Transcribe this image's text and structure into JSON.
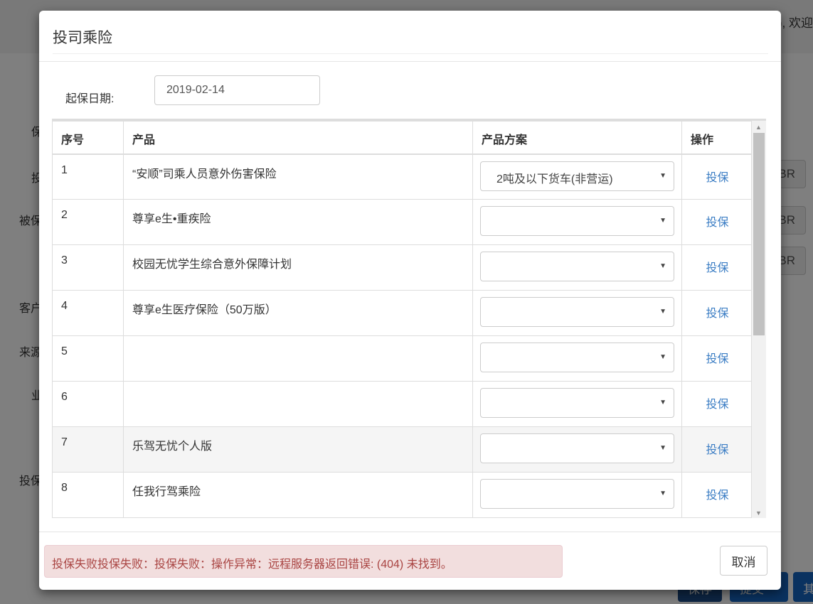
{
  "background": {
    "welcome": "), 欢迎",
    "labels": [
      "保",
      "投",
      "被保",
      "客户",
      "来源",
      "业",
      "投保"
    ],
    "br_buttons": [
      "BR",
      "BR",
      "BR"
    ],
    "bottom_buttons": [
      "保存",
      "提交",
      "其"
    ]
  },
  "modal": {
    "title": "投司乘险",
    "date_label": "起保日期:",
    "date_value": "2019-02-14",
    "columns": [
      "序号",
      "产品",
      "产品方案",
      "操作"
    ],
    "rows": [
      {
        "no": "1",
        "product": "“安顺”司乘人员意外伤害保险",
        "plan": "2吨及以下货车(非营运)",
        "action": "投保"
      },
      {
        "no": "2",
        "product": "尊享e生•重疾险",
        "plan": "",
        "action": "投保"
      },
      {
        "no": "3",
        "product": "校园无忧学生综合意外保障计划",
        "plan": "",
        "action": "投保"
      },
      {
        "no": "4",
        "product": "尊享e生医疗保险（50万版）",
        "plan": "",
        "action": "投保"
      },
      {
        "no": "5",
        "product": "",
        "plan": "",
        "action": "投保"
      },
      {
        "no": "6",
        "product": "",
        "plan": "",
        "action": "投保"
      },
      {
        "no": "7",
        "product": "乐驾无忧个人版",
        "plan": "",
        "action": "投保"
      },
      {
        "no": "8",
        "product": "任我行驾乘险",
        "plan": "",
        "action": "投保"
      }
    ],
    "error": "投保失败投保失败：投保失败：操作异常：远程服务器返回错误: (404) 未找到。",
    "cancel": "取消"
  }
}
